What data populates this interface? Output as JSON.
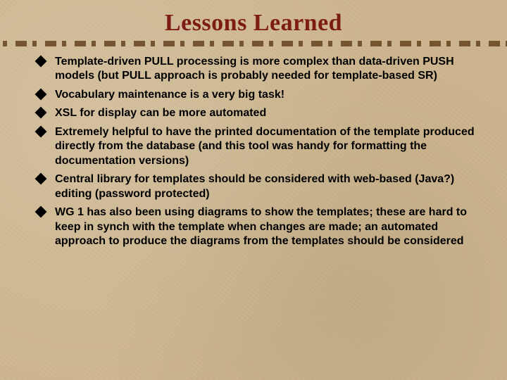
{
  "title": "Lessons Learned",
  "bullets": [
    "Template-driven PULL processing is more complex than data-driven PUSH models (but PULL approach is probably needed for template-based SR)",
    "Vocabulary maintenance is a very big task!",
    "XSL for display can be more automated",
    "Extremely helpful to have the printed documentation of the template produced directly from the database (and this tool was handy for formatting the documentation versions)",
    "Central library for templates should be considered with web-based (Java?) editing (password protected)",
    "WG 1 has also been using diagrams to show the templates; these are hard to keep in synch with the template when changes are made; an automated approach to produce the diagrams from the templates should be considered"
  ]
}
